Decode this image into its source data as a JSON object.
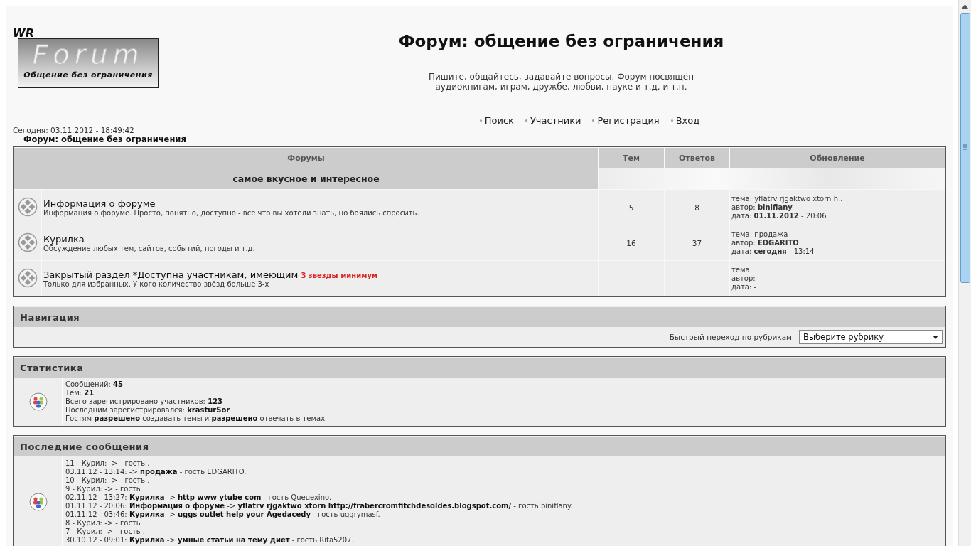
{
  "logo": {
    "badge": "WR",
    "word": "Forum",
    "tagline": "Общение без ограничения"
  },
  "header": {
    "title": "Форум: общение без ограничения",
    "subtitle": "Пишите, общайтесь, задавайте вопросы. Форум посвящён аудиокнигам, играм, дружбе, любви, науке и т.д. и т.п."
  },
  "nav_links": [
    "Поиск",
    "Участники",
    "Регистрация",
    "Вход"
  ],
  "today": "Сегодня: 03.11.2012 - 18:49:42",
  "breadcrumb": "Форум: общение без ограничения",
  "forum_table": {
    "columns": [
      "Форумы",
      "Тем",
      "Ответов",
      "Обновление"
    ],
    "category": "самое вкусное и интересное",
    "rows": [
      {
        "title": "Информация о форуме",
        "note": "",
        "description": "Информация о форуме. Просто, понятно, доступно - всё что вы хотели знать, но боялись спросить.",
        "topics": "5",
        "replies": "8",
        "last": [
          "тема: yflatrv rjgaktwo xtorn h..",
          "автор: **biniflany**",
          "дата: **01.11.2012** - 20:06"
        ]
      },
      {
        "title": "Курилка",
        "note": "",
        "description": "Обсуждение любых тем, сайтов, событий, погоды и т.д.",
        "topics": "16",
        "replies": "37",
        "last": [
          "тема: продажа",
          "автор: **EDGARITO**",
          "дата: **сегодня** - 13:14"
        ]
      },
      {
        "title": "Закрытый раздел *Доступна участникам, имеющим",
        "note": "3 звезды минимум",
        "description": "Только для избранных. У кого количество звёзд больше 3-х",
        "topics": "",
        "replies": "",
        "last": [
          "тема:",
          "автор:",
          "дата: -"
        ]
      }
    ]
  },
  "navigation": {
    "title": "Навигация",
    "jump_label": "Быстрый переход по рубрикам",
    "select_value": "Выберите рубрику"
  },
  "statistics": {
    "title": "Статистика",
    "lines": [
      "Сообщений: **45**",
      "Тем: **21**",
      "Всего зарегистрировано участников: **123**",
      "Последним зарегистрировался: **krasturSor**",
      "Гостям **разрешено** создавать темы и **разрешено** отвечать в темах"
    ]
  },
  "latest": {
    "title": "Последние сообщения",
    "lines": [
      "11 - Курил: -> - гость .",
      "03.11.12 - 13:14: -> **продажа** - гость EDGARITO.",
      "10 - Курил: -> - гость .",
      "9 - Курил: -> - гость .",
      "02.11.12 - 13:27: **Курилка** -> **http www ytube com** - гость Queuexino.",
      "01.11.12 - 20:06: **Информация о форуме** -> **yflatrv rjgaktwo xtorn http://frabercromfitchdesoldes.blogspot.com/** - гость biniflany.",
      "01.11.12 - 03:46: **Курилка** -> **uggs outlet help your Agedacedy** - гость uggrymasf.",
      "8 - Курил: -> - гость .",
      "7 - Курил: -> - гость .",
      "30.10.12 - 09:01: **Курилка** -> **умные статьи на тему диет** - гость Rita5207."
    ]
  }
}
